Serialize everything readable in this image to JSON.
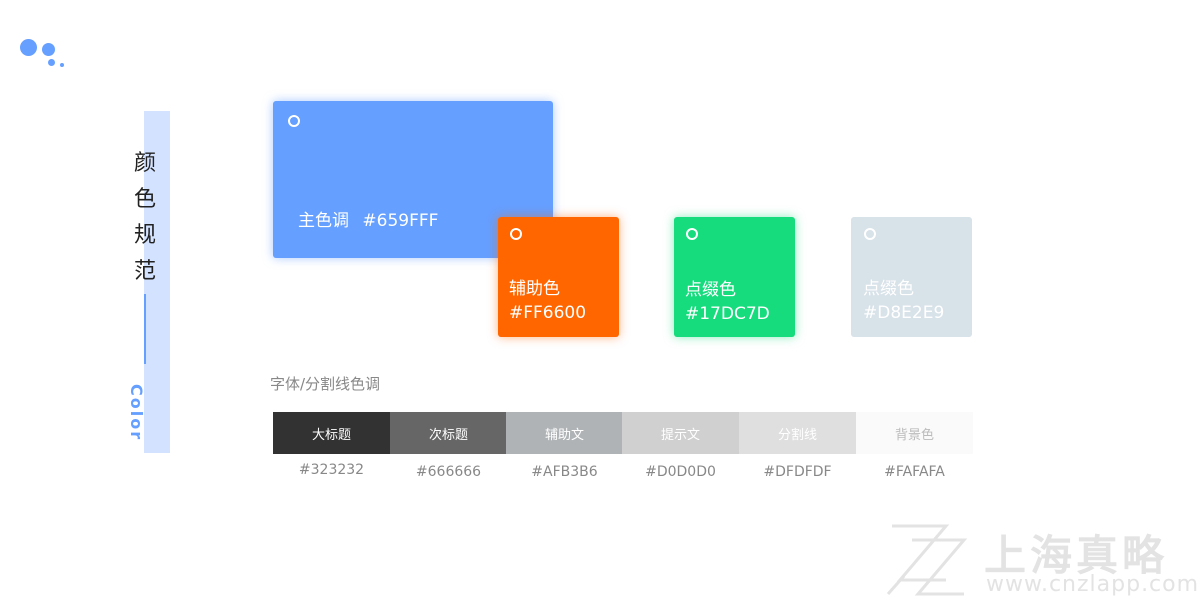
{
  "sidebar": {
    "title_chars": [
      "颜",
      "色",
      "规",
      "范"
    ],
    "subtitle": "Color"
  },
  "cards": {
    "primary": {
      "label": "主色调",
      "hex": "#659FFF",
      "color": "#659FFF"
    },
    "secondary": {
      "label": "辅助色",
      "hex": "#FF6600",
      "color": "#FF6600"
    },
    "accent_green": {
      "label": "点缀色",
      "hex": "#17DC7D",
      "color": "#17DC7D"
    },
    "accent_grey": {
      "label": "点缀色",
      "hex": "#D8E2E9",
      "color": "#D8E2E9"
    }
  },
  "text_colors": {
    "heading": "字体/分割线色调",
    "swatches": [
      {
        "label": "大标题",
        "hex": "#323232"
      },
      {
        "label": "次标题",
        "hex": "#666666"
      },
      {
        "label": "辅助文",
        "hex": "#AFB3B6"
      },
      {
        "label": "提示文",
        "hex": "#D0D0D0"
      },
      {
        "label": "分割线",
        "hex": "#DFDFDF"
      },
      {
        "label": "背景色",
        "hex": "#FAFAFA"
      }
    ]
  },
  "watermark": {
    "brand": "上海真略",
    "url": "www.cnzlapp.com"
  }
}
